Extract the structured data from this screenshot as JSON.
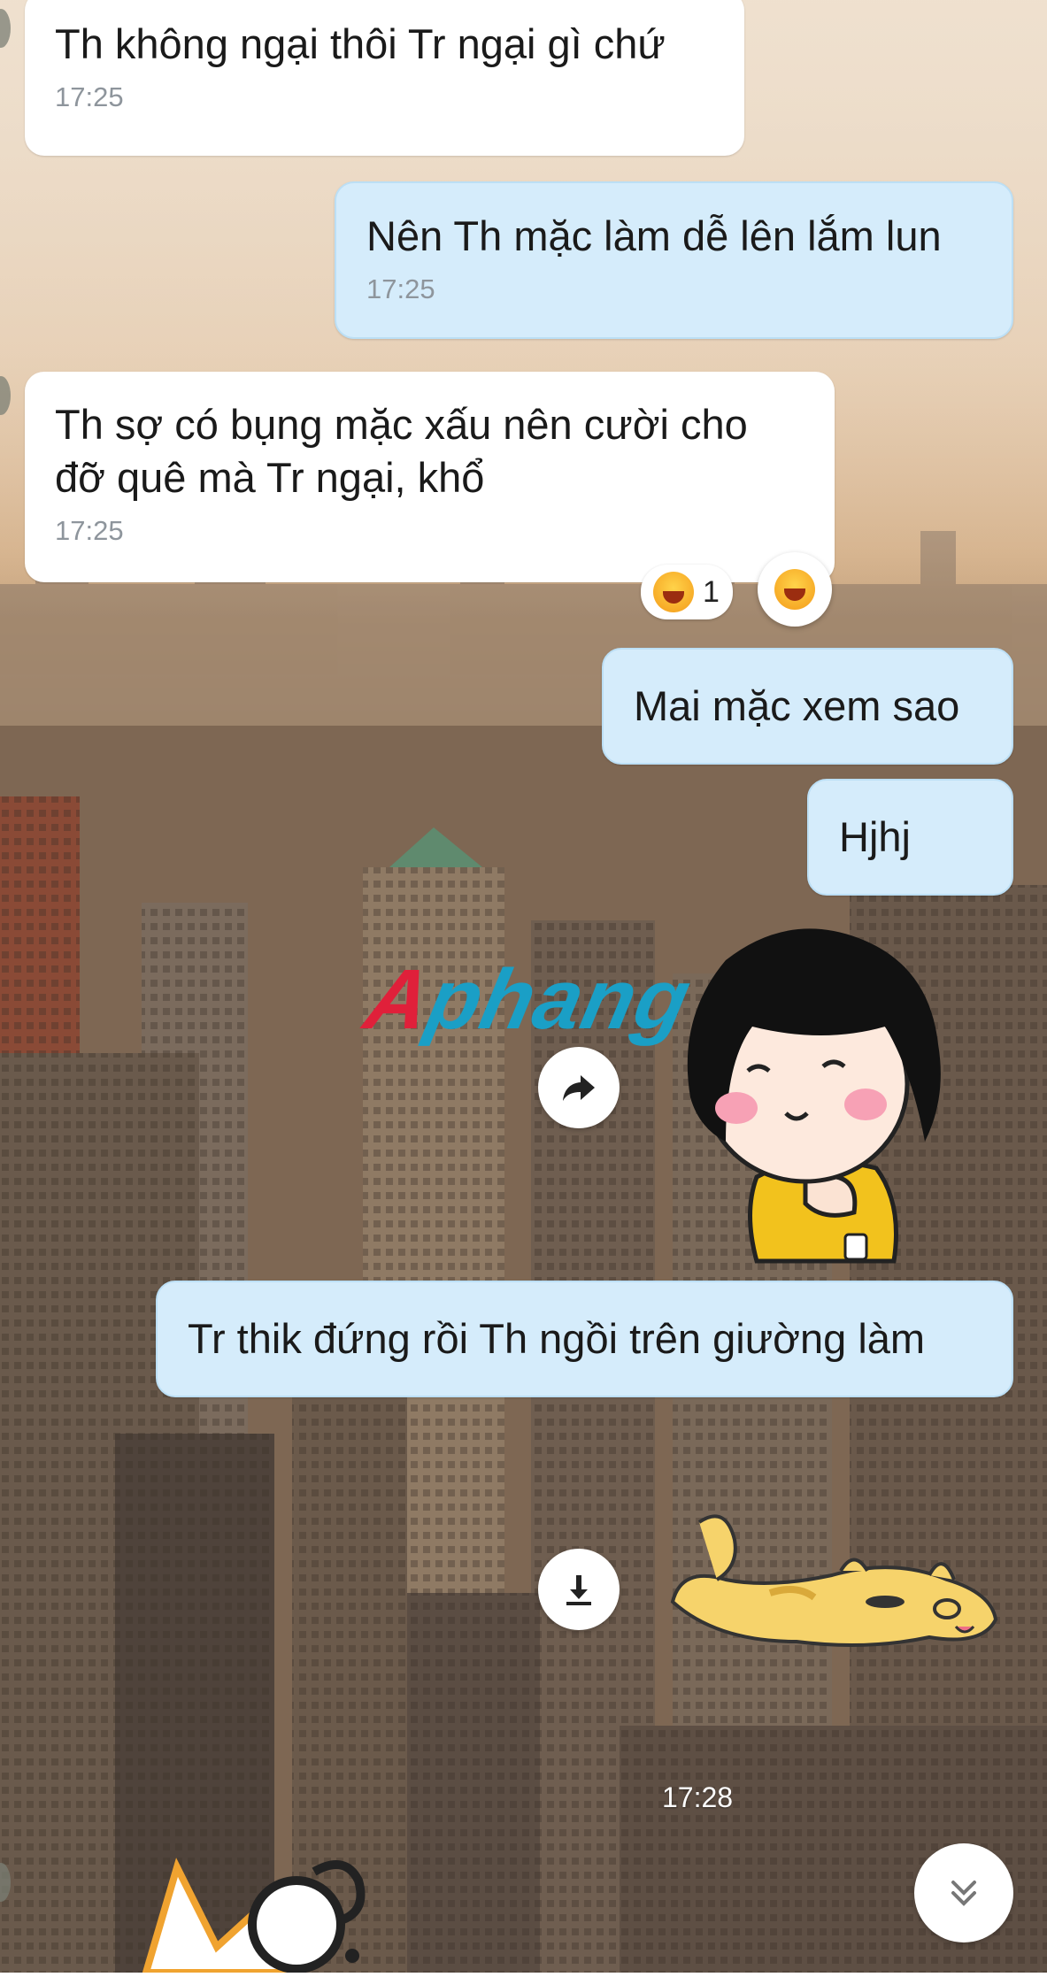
{
  "messages": [
    {
      "text": "Th không ngại thôi Tr ngại gì chứ",
      "time": "17:25"
    },
    {
      "text": "Nên Th mặc làm dễ lên lắm lun",
      "time": "17:25"
    },
    {
      "text": "Th sợ có bụng mặc xấu nên cười cho đỡ quê mà Tr ngại, khổ",
      "time": "17:25"
    },
    {
      "text": "Mai mặc xem sao"
    },
    {
      "text": "Hjhj"
    },
    {
      "text": "Tr thik đứng rồi Th ngồi trên giường làm"
    }
  ],
  "reaction": {
    "count": "1",
    "icon": "laughing-emoji-icon"
  },
  "watermark": {
    "first": "A",
    "rest": "phang"
  },
  "sticker_time": "17:28",
  "colors": {
    "incoming": "#ffffff",
    "outgoing": "#d5ecfb",
    "watermark_red": "#e0203a",
    "watermark_blue": "#1a9fc6"
  },
  "icons": {
    "forward": "forward-arrow-icon",
    "download": "download-icon",
    "scroll_down": "double-chevron-down-icon"
  },
  "stickers": [
    "girl-sticker",
    "cat-lying-sticker",
    "cat-text-sticker"
  ]
}
